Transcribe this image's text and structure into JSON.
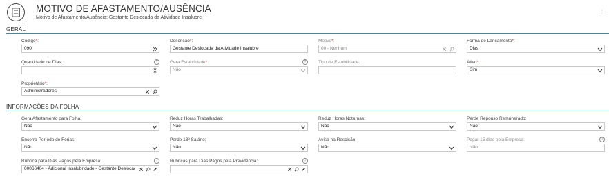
{
  "header": {
    "title": "MOTIVO DE AFASTAMENTO/AUSÊNCIA",
    "subtitle": "Motivo de Afastamento/Ausência: Gestante Deslocada da Atividade Insalubre"
  },
  "sections": {
    "geral": "GERAL",
    "folha": "INFORMAÇÕES DA FOLHA"
  },
  "geral": {
    "codigo": {
      "label": "Código",
      "value": "090"
    },
    "descricao": {
      "label": "Descrição",
      "value": "Gestante Deslocada da Atividade Insalubre"
    },
    "motivo": {
      "label": "Motivo",
      "value": "00 - Nenhum"
    },
    "forma_lancamento": {
      "label": "Forma de Lançamento",
      "value": "Dias"
    },
    "quantidade_dias": {
      "label": "Quantidade de Dias:",
      "value": ""
    },
    "gera_estabilidade": {
      "label": "Gera Estabilidade",
      "value": "Não"
    },
    "tipo_estabilidade": {
      "label": "Tipo de Estabilidade:",
      "value": ""
    },
    "ativo": {
      "label": "Ativo",
      "value": "Sim"
    },
    "proprietario": {
      "label": "Proprietário",
      "value": "Administradores"
    }
  },
  "folha": {
    "gera_afastamento": {
      "label": "Gera Afastamento para Folha:",
      "value": "Não"
    },
    "reduz_horas_trabalhadas": {
      "label": "Reduz Horas Trabalhadas:",
      "value": "Não"
    },
    "reduz_horas_noturnas": {
      "label": "Reduz Horas Noturnas:",
      "value": "Não"
    },
    "perde_repouso": {
      "label": "Perde Repouso Remunerado:",
      "value": "Não"
    },
    "encerra_ferias": {
      "label": "Encerra Período de Férias:",
      "value": "Não"
    },
    "perde_13": {
      "label": "Perde 13º Salário:",
      "value": "Não"
    },
    "avisa_rescisao": {
      "label": "Avisa na Rescisão:",
      "value": "Não"
    },
    "pagar_15_dias": {
      "label": "Pagar 15 dias pela Empresa:",
      "value": "Não"
    },
    "rubrica_empresa": {
      "label": "Rubrica para Dias Pagos pela Empresa:",
      "value": "00066404 - Adicional Insalubridade - Gestante Deslocada"
    },
    "rubrica_previdencia": {
      "label": "Rubricas para Dias Pagos pela Previdência:",
      "value": ""
    }
  },
  "symbols": {
    "required_mark": "*",
    "help_mark": "?",
    "more_mark": "⋮"
  },
  "colors": {
    "accent_line": "#2b8ac9",
    "required": "#d03131"
  }
}
